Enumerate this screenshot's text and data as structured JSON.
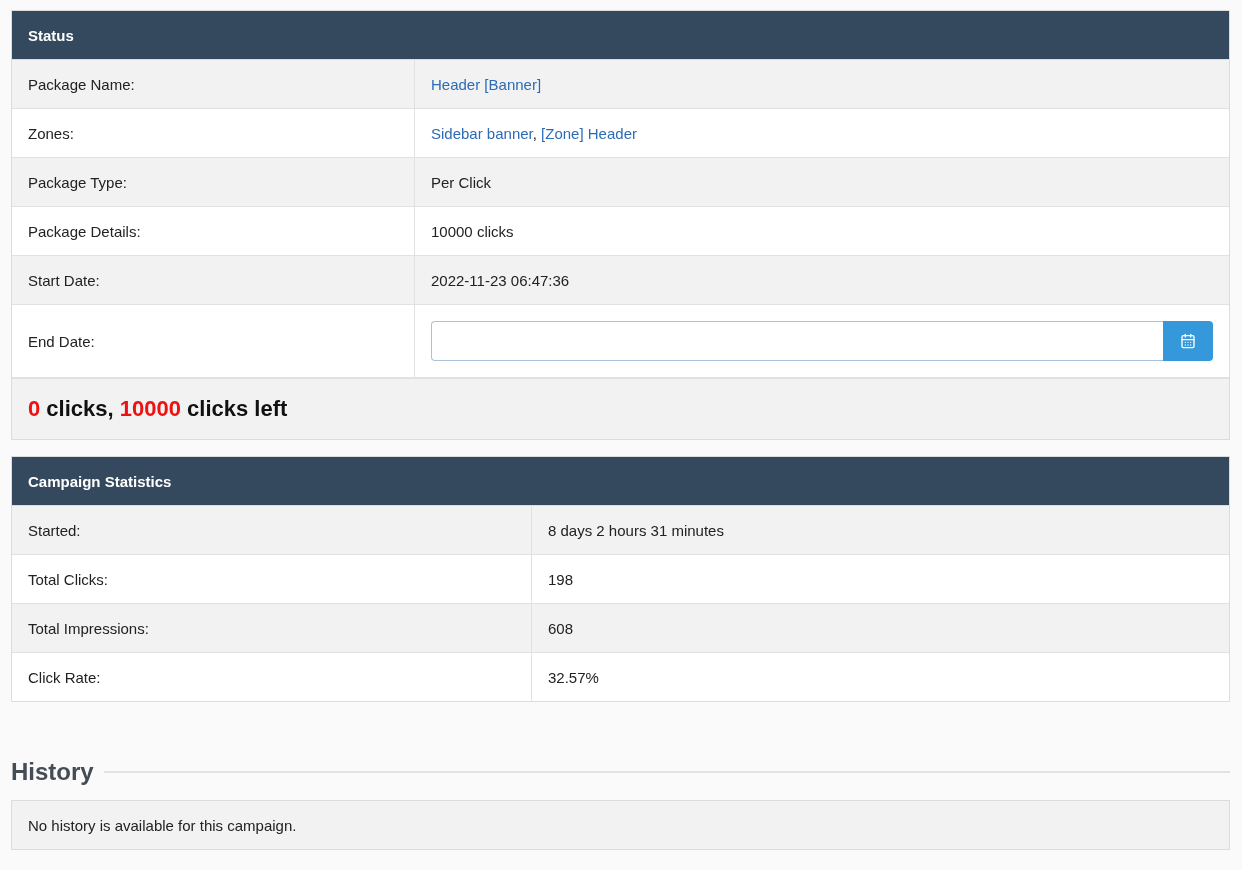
{
  "status": {
    "title": "Status",
    "rows": [
      {
        "label": "Package Name:",
        "kind": "links",
        "links": [
          "Header [Banner]"
        ]
      },
      {
        "label": "Zones:",
        "kind": "links",
        "links": [
          "Sidebar banner",
          "[Zone] Header"
        ],
        "separator": ","
      },
      {
        "label": "Package Type:",
        "kind": "text",
        "value": "Per Click"
      },
      {
        "label": "Package Details:",
        "kind": "text",
        "value": "10000 clicks"
      },
      {
        "label": "Start Date:",
        "kind": "text",
        "value": "2022-11-23 06:47:36"
      },
      {
        "label": "End Date:",
        "kind": "date_field"
      }
    ],
    "summary": [
      {
        "text": "0",
        "highlight": true
      },
      {
        "text": " clicks, ",
        "highlight": false
      },
      {
        "text": "10000",
        "highlight": true
      },
      {
        "text": " clicks left",
        "highlight": false
      }
    ]
  },
  "statistics": {
    "title": "Campaign Statistics",
    "rows": [
      {
        "label": "Started:",
        "value": "8 days 2 hours 31 minutes"
      },
      {
        "label": "Total Clicks:",
        "value": "198"
      },
      {
        "label": "Total Impressions:",
        "value": "608"
      },
      {
        "label": "Click Rate:",
        "value": "32.57%"
      }
    ]
  },
  "history": {
    "title": "History",
    "message": "No history is available for this campaign."
  }
}
